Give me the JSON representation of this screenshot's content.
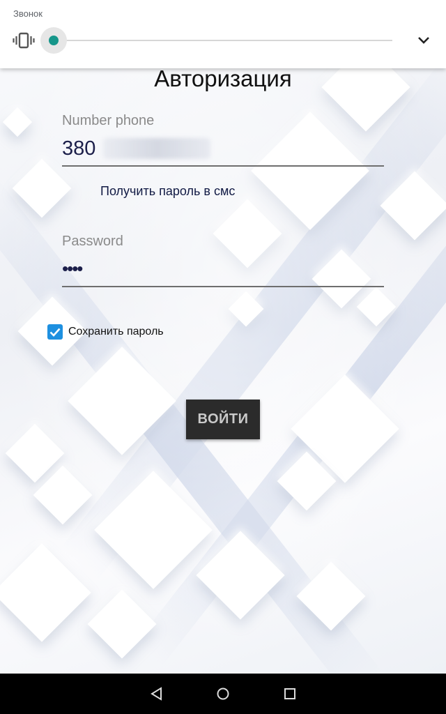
{
  "volume_panel": {
    "title": "Звонок",
    "mode_icon": "vibrate-icon",
    "expand_icon": "chevron-down-icon",
    "level": 0
  },
  "form": {
    "title": "Авторизация",
    "phone": {
      "label": "Number phone",
      "value": "380",
      "value_redacted": true
    },
    "sms_link": "Получить пароль в смс",
    "password": {
      "label": "Password",
      "value": "••••"
    },
    "remember": {
      "label": "Сохранить пароль",
      "checked": true
    },
    "login_button": "ВОЙТИ"
  },
  "nav_bar": {
    "back_icon": "back-triangle-icon",
    "home_icon": "home-circle-icon",
    "recent_icon": "recents-square-icon"
  },
  "colors": {
    "accent": "#16968a",
    "checkbox": "#1e90e0",
    "text_dark": "#1c1f4a",
    "button_bg": "#2b2b2b"
  }
}
